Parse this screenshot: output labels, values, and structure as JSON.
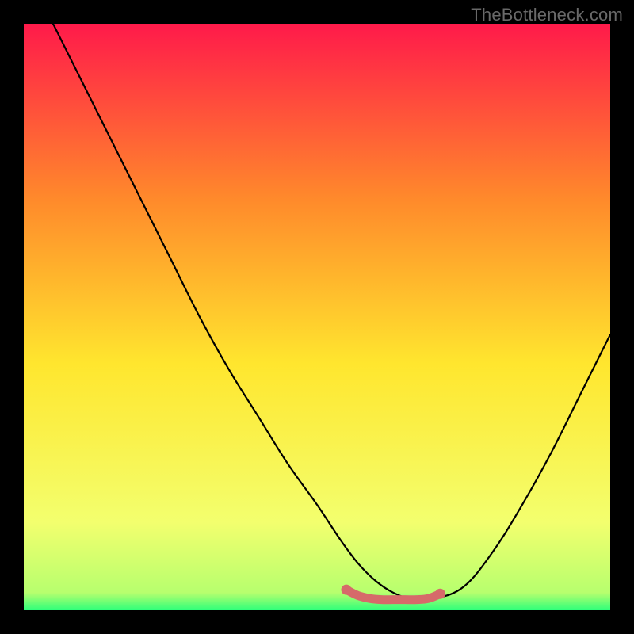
{
  "watermark": "TheBottleneck.com",
  "colors": {
    "frame": "#000000",
    "gradient_top": "#ff1a4a",
    "gradient_mid1": "#ff8a2b",
    "gradient_mid2": "#ffe62e",
    "gradient_mid3": "#f3ff6e",
    "gradient_bottom": "#2eff7a",
    "curve": "#000000",
    "marker": "#d66a6a",
    "watermark": "#696969"
  },
  "chart_data": {
    "type": "line",
    "title": "",
    "xlabel": "",
    "ylabel": "",
    "xlim": [
      0,
      100
    ],
    "ylim": [
      0,
      100
    ],
    "series": [
      {
        "name": "bottleneck-curve",
        "x": [
          5,
          10,
          15,
          20,
          25,
          30,
          35,
          40,
          45,
          50,
          54,
          57,
          60,
          63,
          66,
          70,
          75,
          80,
          85,
          90,
          95,
          100
        ],
        "y": [
          100,
          90,
          80,
          70,
          60,
          50,
          41,
          33,
          25,
          18,
          12,
          8,
          5,
          3,
          2,
          2,
          4,
          10,
          18,
          27,
          37,
          47
        ]
      },
      {
        "name": "optimal-range-marker",
        "x": [
          55,
          57,
          59,
          61,
          63,
          65,
          67,
          69,
          71
        ],
        "y": [
          3.5,
          2.5,
          2.0,
          1.8,
          1.8,
          1.8,
          1.8,
          2.0,
          2.8
        ]
      }
    ],
    "annotations": []
  }
}
